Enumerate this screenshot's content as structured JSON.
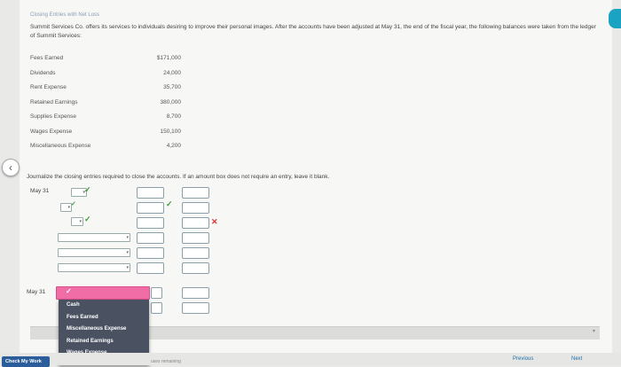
{
  "header": {
    "title": "Closing Entries with Net Loss"
  },
  "description": "Summit Services Co. offers its services to individuals desiring to improve their personal images. After the accounts have been adjusted at May 31, the end of the fiscal year, the following balances were taken from the ledger of Summit Services:",
  "ledger": [
    {
      "name": "Fees Earned",
      "value": "$171,000"
    },
    {
      "name": "Dividends",
      "value": "24,000"
    },
    {
      "name": "Rent Expense",
      "value": "35,700"
    },
    {
      "name": "Retained Earnings",
      "value": "380,000"
    },
    {
      "name": "Supplies Expense",
      "value": "8,700"
    },
    {
      "name": "Wages Expense",
      "value": "150,100"
    },
    {
      "name": "Miscellaneous Expense",
      "value": "4,200"
    }
  ],
  "instruction": "Journalize the closing entries required to close the accounts. If an amount box does not require an entry, leave it blank.",
  "journal": {
    "date_1": "May 31",
    "date_2": "May 31"
  },
  "dropdown": {
    "options": [
      "Cash",
      "Fees Earned",
      "Miscellaneous Expense",
      "Retained Earnings",
      "Wages Expense"
    ]
  },
  "footer": {
    "check_label": "Check My Work",
    "remaining": "uses remaining",
    "previous_label": "Previous",
    "next_label": "Next"
  },
  "colors": {
    "check": "#3a9a3a",
    "error": "#dd3333",
    "dropdown_highlight": "#f06ea5",
    "accent": "#1aa3c2"
  }
}
